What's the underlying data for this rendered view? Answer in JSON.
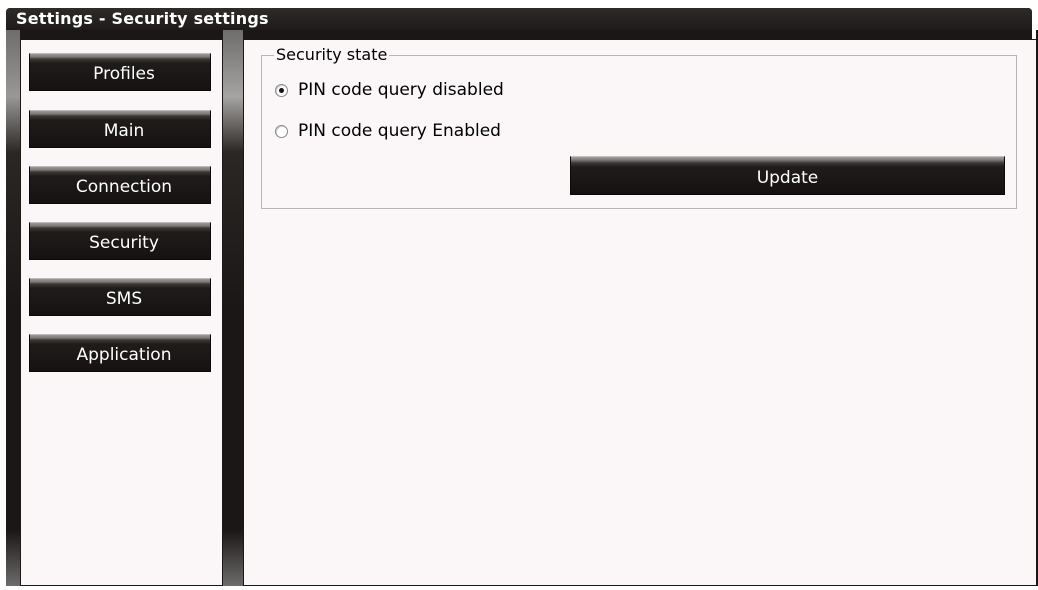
{
  "window": {
    "title": "Settings - Security settings"
  },
  "sidebar": {
    "items": [
      {
        "label": "Profiles"
      },
      {
        "label": "Main"
      },
      {
        "label": "Connection"
      },
      {
        "label": "Security"
      },
      {
        "label": "SMS"
      },
      {
        "label": "Application"
      }
    ]
  },
  "security_state": {
    "legend": "Security state",
    "options": [
      {
        "label": "PIN code query disabled",
        "checked": true
      },
      {
        "label": "PIN code query Enabled",
        "checked": false
      }
    ],
    "update_label": "Update"
  },
  "colors": {
    "frame": "#1a1716",
    "panel_bg": "#fbf6f8",
    "button_bg": "#151211",
    "button_text": "#ffffff"
  },
  "icons": {
    "radio_checked": "radio-checked-icon",
    "radio_unchecked": "radio-unchecked-icon"
  }
}
